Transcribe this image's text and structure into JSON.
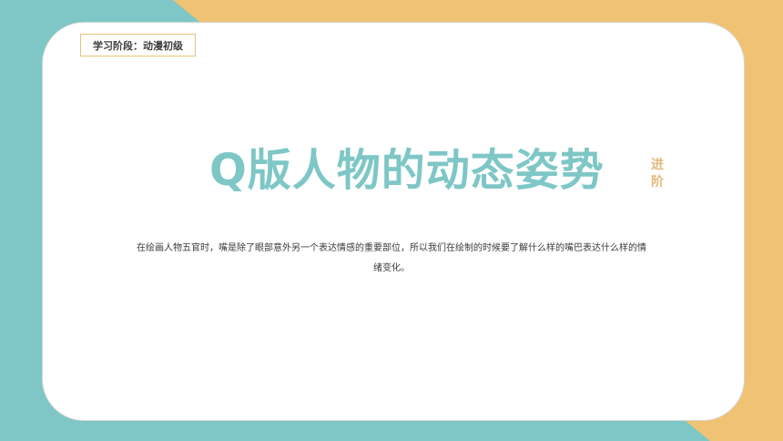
{
  "slide": {
    "stage_label": "学习阶段：动漫初级",
    "title": "Q版人物的动态姿势",
    "advanced_tag": "进阶",
    "description": "在绘画人物五官时，嘴是除了眼部意外另一个表达情感的重要部位，所以我们在绘制的时候要了解什么样的嘴巴表达什么样的情绪变化。"
  },
  "colors": {
    "teal": "#7ec7c6",
    "orange": "#f0c273",
    "gold_text": "#e2b97b"
  }
}
